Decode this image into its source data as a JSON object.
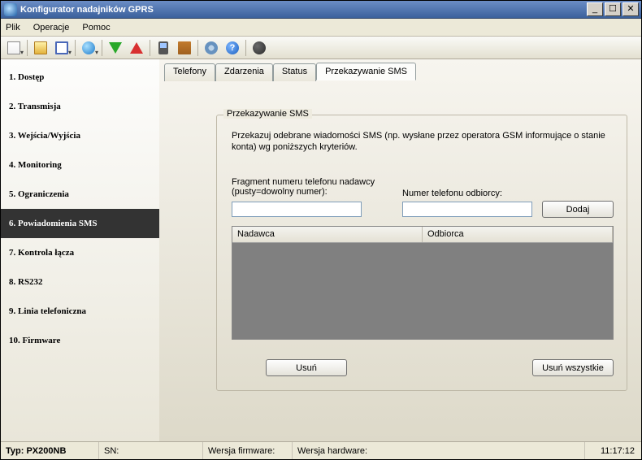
{
  "window": {
    "title": "Konfigurator nadajników GPRS"
  },
  "menu": {
    "file": "Plik",
    "operations": "Operacje",
    "help": "Pomoc"
  },
  "toolbar": {
    "icons": [
      "document-icon",
      "folder-open-icon",
      "save-icon",
      "globe-icon",
      "arrow-down-icon",
      "arrow-up-icon",
      "device-icon",
      "book-icon",
      "gear-icon",
      "help-icon",
      "dark-globe-icon"
    ]
  },
  "sidebar": {
    "items": [
      {
        "label": "1. Dostęp"
      },
      {
        "label": "2. Transmisja"
      },
      {
        "label": "3. Wejścia/Wyjścia"
      },
      {
        "label": "4. Monitoring"
      },
      {
        "label": "5. Ograniczenia"
      },
      {
        "label": "6. Powiadomienia SMS"
      },
      {
        "label": "7. Kontrola łącza"
      },
      {
        "label": "8. RS232"
      },
      {
        "label": "9. Linia telefoniczna"
      },
      {
        "label": "10. Firmware"
      }
    ],
    "selected_index": 5
  },
  "tabs": {
    "items": [
      {
        "label": "Telefony"
      },
      {
        "label": "Zdarzenia"
      },
      {
        "label": "Status"
      },
      {
        "label": "Przekazywanie SMS"
      }
    ],
    "active_index": 3
  },
  "panel": {
    "title": "Przekazywanie SMS",
    "description": "Przekazuj odebrane wiadomości SMS (np. wysłane przez operatora GSM informujące o stanie konta) wg poniższych kryteriów.",
    "sender_label": "Fragment numeru telefonu nadawcy (pusty=dowolny numer):",
    "recipient_label": "Numer telefonu odbiorcy:",
    "sender_value": "",
    "recipient_value": "",
    "add_button": "Dodaj",
    "grid": {
      "columns": [
        "Nadawca",
        "Odbiorca"
      ],
      "rows": []
    },
    "delete_button": "Usuń",
    "delete_all_button": "Usuń wszystkie"
  },
  "status": {
    "type_label": "Typ:",
    "type_value": "PX200NB",
    "sn_label": "SN:",
    "sn_value": "",
    "fw_label": "Wersja firmware:",
    "fw_value": "",
    "hw_label": "Wersja hardware:",
    "hw_value": "",
    "time": "11:17:12"
  }
}
